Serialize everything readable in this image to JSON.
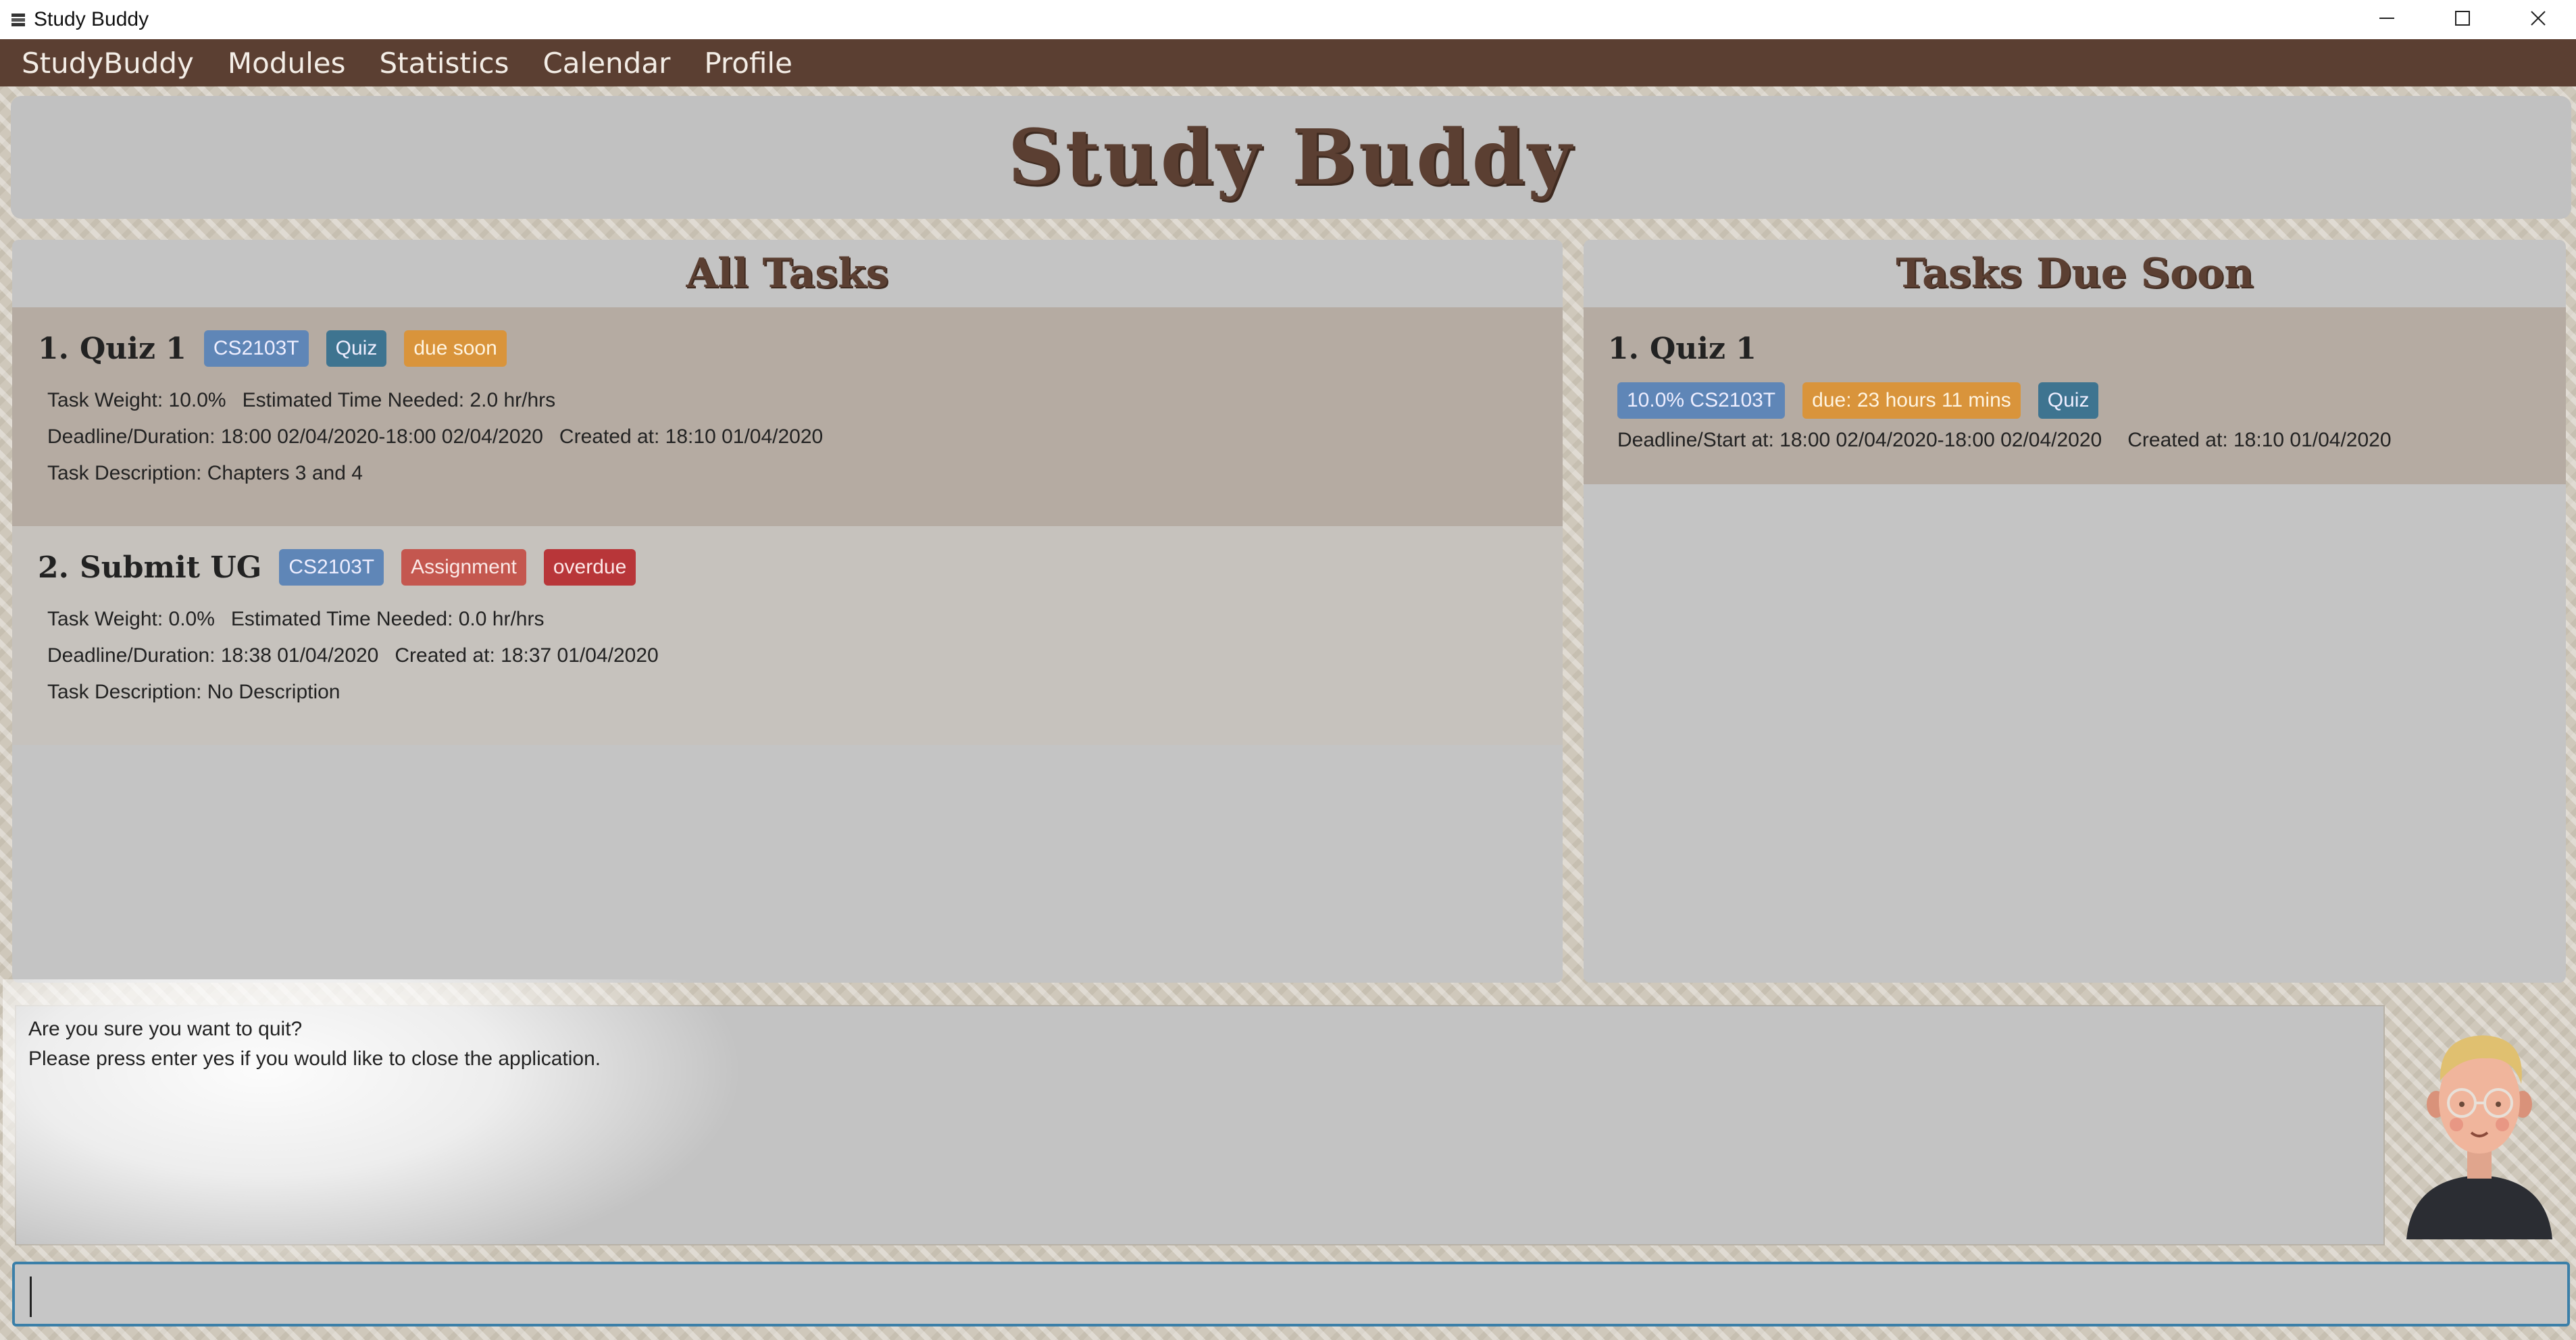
{
  "window": {
    "title": "Study Buddy"
  },
  "menu": {
    "items": [
      "StudyBuddy",
      "Modules",
      "Statistics",
      "Calendar",
      "Profile"
    ]
  },
  "banner": {
    "title": "Study Buddy"
  },
  "all_tasks": {
    "header": "All Tasks",
    "tasks": [
      {
        "index": "1.",
        "name": "Quiz 1",
        "tags": [
          "CS2103T",
          "Quiz",
          "due soon"
        ],
        "weight": "Task Weight: 10.0%",
        "time": "Estimated Time Needed: 2.0 hr/hrs",
        "deadline": "Deadline/Duration: 18:00 02/04/2020-18:00 02/04/2020",
        "created": "Created at: 18:10 01/04/2020",
        "description": "Task Description: Chapters 3 and 4"
      },
      {
        "index": "2.",
        "name": "Submit UG",
        "tags": [
          "CS2103T",
          "Assignment",
          "overdue"
        ],
        "weight": "Task Weight: 0.0%",
        "time": "Estimated Time Needed: 0.0 hr/hrs",
        "deadline": "Deadline/Duration: 18:38 01/04/2020",
        "created": "Created at: 18:37 01/04/2020",
        "description": "Task Description: No Description"
      }
    ]
  },
  "due_soon": {
    "header": "Tasks Due Soon",
    "tasks": [
      {
        "index": "1.",
        "name": "Quiz 1",
        "tags": [
          "10.0% CS2103T",
          "due: 23 hours 11 mins",
          "Quiz"
        ],
        "deadline": "Deadline/Start at: 18:00 02/04/2020-18:00 02/04/2020",
        "created": "Created at: 18:10 01/04/2020"
      }
    ]
  },
  "result": {
    "line1": "Are you sure you want to quit?",
    "line2": "Please press enter yes if you would like to close the application."
  },
  "command": {
    "value": ""
  },
  "colors": {
    "menu_bg": "#5b3f32",
    "brand_brown": "#5b3f32",
    "tag_module": "#5f86b7",
    "tag_type": "#3e7490",
    "tag_due_soon": "#d9943b",
    "tag_assignment": "#c4574f",
    "tag_overdue": "#b83639",
    "command_border": "#3b7fa8"
  },
  "icons": {
    "app": "stack-icon",
    "minimize": "minimize-icon",
    "maximize": "maximize-icon",
    "close": "close-icon",
    "avatar": "avatar-illustration"
  }
}
